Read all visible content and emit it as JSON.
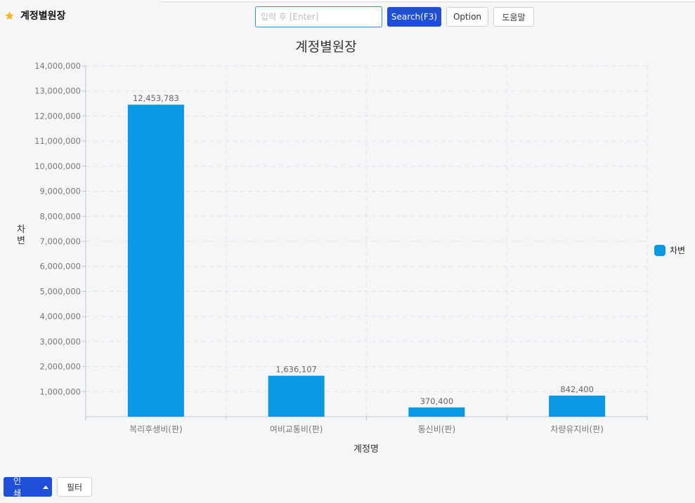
{
  "header": {
    "title": "계정별원장",
    "star_icon": "star-icon"
  },
  "search": {
    "placeholder": "입력 후 [Enter]",
    "value": ""
  },
  "toolbar": {
    "search_label": "Search(F3)",
    "option_label": "Option",
    "help_label": "도움말"
  },
  "footer": {
    "print_label": "인쇄",
    "filter_label": "필터"
  },
  "colors": {
    "bar": "#0999e4",
    "primary": "#1f4fd8",
    "accent_star": "#f5b625"
  },
  "chart_data": {
    "type": "bar",
    "title": "계정별원장",
    "xlabel": "계정명",
    "ylabel": "차변",
    "categories": [
      "복리후생비(판)",
      "여비교통비(판)",
      "통신비(판)",
      "차량유지비(판)"
    ],
    "series": [
      {
        "name": "차변",
        "values": [
          12453783,
          1636107,
          370400,
          842400
        ]
      }
    ],
    "data_labels": [
      "12,453,783",
      "1,636,107",
      "370,400",
      "842,400"
    ],
    "ylim": [
      0,
      14000000
    ],
    "yticks": [
      "1,000,000",
      "2,000,000",
      "3,000,000",
      "4,000,000",
      "5,000,000",
      "6,000,000",
      "7,000,000",
      "8,000,000",
      "9,000,000",
      "10,000,000",
      "11,000,000",
      "12,000,000",
      "13,000,000",
      "14,000,000"
    ],
    "grid": true,
    "legend": "right"
  }
}
